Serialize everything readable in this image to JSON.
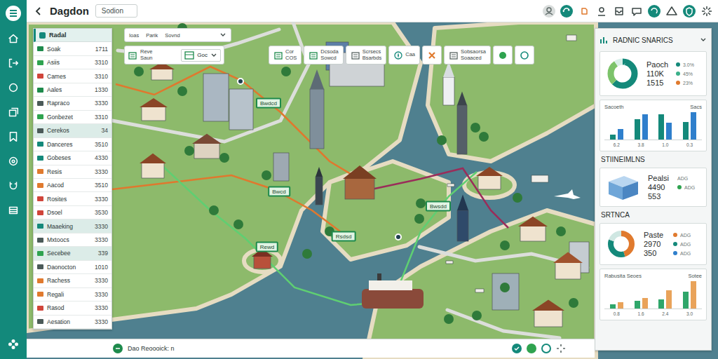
{
  "window": {
    "title": "Dagdon"
  },
  "search": {
    "value": "Sodion"
  },
  "list": {
    "title": "Radal",
    "items": [
      {
        "label": "Soak",
        "value": "1711",
        "color": "#1e8a4c",
        "selected": false
      },
      {
        "label": "Asiis",
        "value": "3310",
        "color": "#2fa34f",
        "selected": false
      },
      {
        "label": "Cames",
        "value": "3310",
        "color": "#d0453a",
        "selected": false
      },
      {
        "label": "Aales",
        "value": "1330",
        "color": "#1e8a4c",
        "selected": false
      },
      {
        "label": "Rapraco",
        "value": "3330",
        "color": "#4b5a58",
        "selected": false
      },
      {
        "label": "Gonbezet",
        "value": "3310",
        "color": "#2fa34f",
        "selected": false
      },
      {
        "label": "Cerekos",
        "value": "34",
        "color": "#4b5a58",
        "selected": true
      },
      {
        "label": "Danceres",
        "value": "3510",
        "color": "#14897a",
        "selected": false
      },
      {
        "label": "Gobeses",
        "value": "4330",
        "color": "#14897a",
        "selected": false
      },
      {
        "label": "Resis",
        "value": "3330",
        "color": "#e07a2e",
        "selected": false
      },
      {
        "label": "Aacod",
        "value": "3510",
        "color": "#e07a2e",
        "selected": false
      },
      {
        "label": "Rosites",
        "value": "3330",
        "color": "#d0453a",
        "selected": false
      },
      {
        "label": "Dsoel",
        "value": "3530",
        "color": "#d0453a",
        "selected": false
      },
      {
        "label": "Maaeking",
        "value": "3330",
        "color": "#14897a",
        "selected": true
      },
      {
        "label": "Mxtoocs",
        "value": "3330",
        "color": "#4b5a58",
        "selected": false
      },
      {
        "label": "Secebee",
        "value": "339",
        "color": "#2fa34f",
        "selected": true
      },
      {
        "label": "Daonocton",
        "value": "1010",
        "color": "#4b5a58",
        "selected": false
      },
      {
        "label": "Rachess",
        "value": "3330",
        "color": "#e07a2e",
        "selected": false
      },
      {
        "label": "Regali",
        "value": "3330",
        "color": "#e07a2e",
        "selected": false
      },
      {
        "label": "Rasod",
        "value": "3330",
        "color": "#d0453a",
        "selected": false
      },
      {
        "label": "Aesation",
        "value": "3330",
        "color": "#4b5a58",
        "selected": false
      }
    ]
  },
  "toolbar": {
    "dropdown": [
      "Ioas",
      "Parik",
      "Sovnd"
    ],
    "main_card": {
      "title": "Reve",
      "sub": "Saun",
      "field": "Goc"
    },
    "chips": [
      {
        "kind": "text",
        "label": "Cor",
        "sub": "COS",
        "color": "#1e8a4c"
      },
      {
        "kind": "text",
        "label": "Dcsoda",
        "sub": "Sowcd",
        "color": "#1e8a4c"
      },
      {
        "kind": "text",
        "label": "Scrsecs",
        "sub": "Bsarbds",
        "color": "#5a6664"
      },
      {
        "kind": "text",
        "label": "Caa",
        "color": "#14897a"
      },
      {
        "kind": "icon",
        "color": "#e07a2e"
      },
      {
        "kind": "text",
        "label": "Sobsaorsa",
        "sub": "Soaaced",
        "color": "#5a6664"
      },
      {
        "kind": "icon",
        "color": "#2fa34f"
      },
      {
        "kind": "icon",
        "color": "#14897a"
      }
    ]
  },
  "map": {
    "pins": [
      "Bwdcd",
      "Bwcd",
      "Bwsdd",
      "Rsdsd",
      "Rewd"
    ]
  },
  "stats": {
    "title": "RADNIC SNARICS",
    "donut1": {
      "segments": [
        {
          "value": 62,
          "color": "#14897a"
        },
        {
          "value": 28,
          "color": "#7cc36a"
        },
        {
          "value": 10,
          "color": "#d9efe9"
        }
      ],
      "lines": [
        {
          "label": "Paoch",
          "note": "3.0%",
          "color": "#14897a"
        },
        {
          "label": "110K",
          "note": "45%",
          "color": "#3cb08a"
        },
        {
          "label": "1515",
          "note": "23%",
          "color": "#e07a2e"
        }
      ]
    },
    "chart1": {
      "title": "Sacoeth",
      "unit": "Sacs",
      "series": [
        {
          "color": "#14897a",
          "values": [
            8,
            34,
            42,
            30
          ]
        },
        {
          "color": "#2f7fcc",
          "values": [
            18,
            42,
            28,
            46
          ]
        }
      ],
      "ticks": [
        "6.2",
        "3.8",
        "1.0",
        "0.3"
      ]
    },
    "section2": "STIINEIMLNS",
    "cube_card": {
      "lines": [
        {
          "label": "Pealsi",
          "note": "ADG"
        },
        {
          "label": "4490",
          "note": "ADG",
          "color": "#2fa34f"
        },
        {
          "label": "553"
        }
      ]
    },
    "section3": "SRTNCA",
    "donut2": {
      "segments": [
        {
          "value": 45,
          "color": "#e07a2e"
        },
        {
          "value": 35,
          "color": "#14897a"
        },
        {
          "value": 20,
          "color": "#cfe7e2"
        }
      ],
      "lines": [
        {
          "label": "Paste",
          "note": "ADG",
          "color": "#e07a2e"
        },
        {
          "label": "2970",
          "note": "ADG",
          "color": "#14897a"
        },
        {
          "label": "350",
          "note": "ADG",
          "color": "#2f7fcc"
        }
      ]
    },
    "chart2": {
      "title": "Rabusita Seoes",
      "unit": "Sotee",
      "series": [
        {
          "color": "#2fa66a",
          "values": [
            6,
            10,
            12,
            22
          ]
        },
        {
          "color": "#e9a35a",
          "values": [
            8,
            14,
            24,
            36
          ]
        }
      ],
      "ticks": [
        "0.8",
        "1.6",
        "2.4",
        "3.0"
      ]
    }
  },
  "status_bar": {
    "text": "Dao Reoooick: n"
  }
}
